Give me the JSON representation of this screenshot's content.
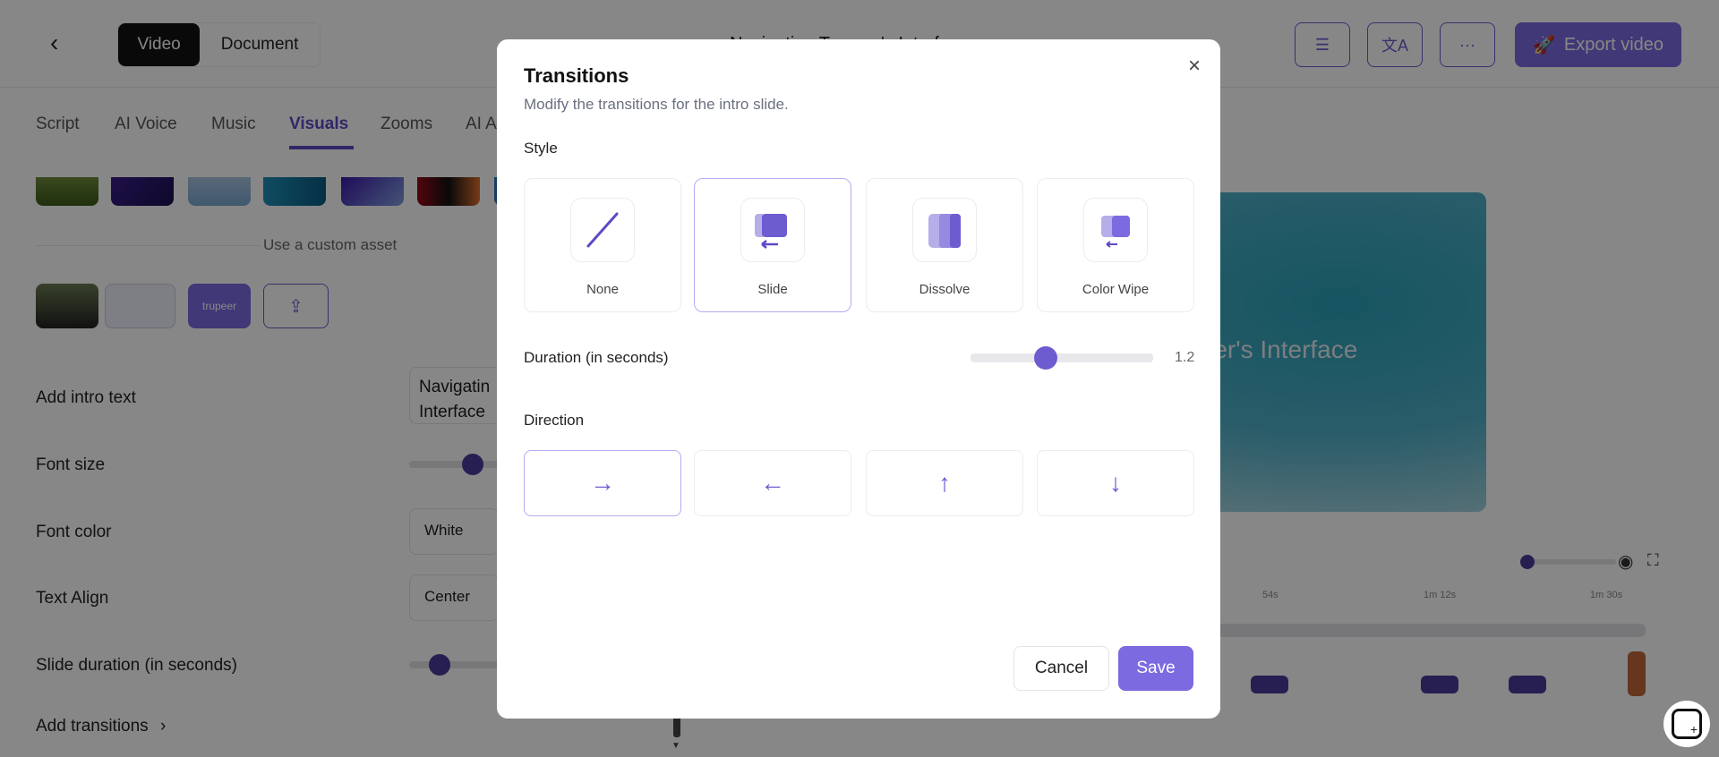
{
  "header": {
    "back_icon": "chevron-left-icon",
    "mode_tabs": [
      "Video",
      "Document"
    ],
    "active_mode": "Video",
    "title": "Navigating Trupeer's Interface",
    "export_label": "Export video"
  },
  "tabs": [
    "Script",
    "AI Voice",
    "Music",
    "Visuals",
    "Zooms",
    "AI A"
  ],
  "active_tab": "Visuals",
  "assets": {
    "custom_asset_label": "Use a custom asset",
    "trupeer_thumb": "trupeer"
  },
  "settings": {
    "intro_text_label": "Add intro text",
    "intro_text_value": "Navigatin\nInterface",
    "font_size_label": "Font size",
    "font_color_label": "Font color",
    "font_color_value": "White",
    "text_align_label": "Text Align",
    "text_align_value": "Center",
    "slide_duration_label": "Slide duration (in seconds)",
    "add_transitions_label": "Add transitions"
  },
  "preview": {
    "text": "Navigating Trupeer's Interface"
  },
  "timeline": {
    "labels": [
      "54s",
      "1m 12s",
      "1m 30s"
    ]
  },
  "modal": {
    "title": "Transitions",
    "subtitle": "Modify the transitions for the intro slide.",
    "style_label": "Style",
    "styles": [
      "None",
      "Slide",
      "Dissolve",
      "Color Wipe"
    ],
    "selected_style": "Slide",
    "duration_label": "Duration (in seconds)",
    "duration_value": "1.2",
    "duration_range": [
      0,
      3
    ],
    "direction_label": "Direction",
    "directions": [
      "→",
      "←",
      "↑",
      "↓"
    ],
    "selected_direction": "→",
    "cancel_label": "Cancel",
    "save_label": "Save"
  },
  "colors": {
    "accent": "#6c5ccf",
    "export": "#7b6ae0"
  }
}
